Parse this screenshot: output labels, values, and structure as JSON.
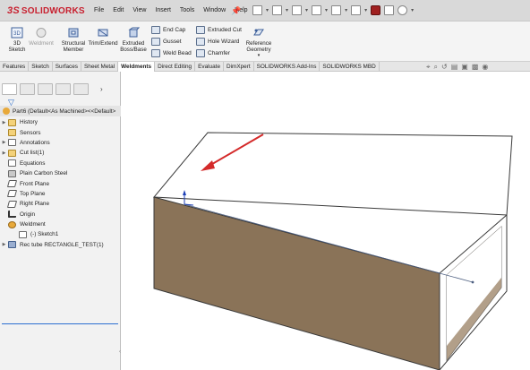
{
  "app": {
    "brand": "SOLIDWORKS",
    "brand_prefix": "3S"
  },
  "menu": [
    "File",
    "Edit",
    "View",
    "Insert",
    "Tools",
    "Window",
    "Help"
  ],
  "ribbon": {
    "buttons": [
      {
        "id": "3d-sketch",
        "label": "3D Sketch",
        "enabled": true
      },
      {
        "id": "weldment",
        "label": "Weldment",
        "enabled": false
      },
      {
        "id": "structural-member",
        "label": "Structural Member",
        "enabled": true
      },
      {
        "id": "trim-extend",
        "label": "Trim/Extend",
        "enabled": true
      },
      {
        "id": "extruded-boss",
        "label": "Extruded Boss/Base",
        "enabled": true
      }
    ],
    "small": [
      "End Cap",
      "Gusset",
      "Weld Bead",
      "Extruded Cut",
      "Hole Wizard",
      "Chamfer"
    ],
    "reference_geometry": "Reference Geometry"
  },
  "tabs": {
    "items": [
      "Features",
      "Sketch",
      "Surfaces",
      "Sheet Metal",
      "Weldments",
      "Direct Editing",
      "Evaluate",
      "DimXpert",
      "SOLIDWORKS Add-Ins",
      "SOLIDWORKS MBD"
    ],
    "active": "Weldments"
  },
  "tree": {
    "root": "Part6 (Default<As Machined><<Default>",
    "items": [
      {
        "label": "History",
        "icon": "history-icon",
        "expandable": true
      },
      {
        "label": "Sensors",
        "icon": "sensors-icon",
        "expandable": false
      },
      {
        "label": "Annotations",
        "icon": "annotations-icon",
        "expandable": true
      },
      {
        "label": "Cut list(1)",
        "icon": "cut-list-icon",
        "expandable": true
      },
      {
        "label": "Equations",
        "icon": "equations-icon",
        "expandable": false
      },
      {
        "label": "Plain Carbon Steel",
        "icon": "material-icon",
        "expandable": false
      },
      {
        "label": "Front Plane",
        "icon": "plane-icon",
        "expandable": false
      },
      {
        "label": "Top Plane",
        "icon": "plane-icon",
        "expandable": false
      },
      {
        "label": "Right Plane",
        "icon": "plane-icon",
        "expandable": false
      },
      {
        "label": "Origin",
        "icon": "origin-icon",
        "expandable": false
      },
      {
        "label": "Weldment",
        "icon": "weldment-icon",
        "expandable": false
      },
      {
        "label": "(-) Sketch1",
        "icon": "sketch-icon",
        "expandable": false,
        "sub": true
      },
      {
        "label": "Rec tube RECTANGLE_TEST(1)",
        "icon": "rec-tube-icon",
        "expandable": true
      }
    ]
  },
  "colors": {
    "arrow": "#d42a2a",
    "tube_face": "#8a7358",
    "tube_inner": "#a48e74",
    "active_tab_bg": "#ffffff",
    "selection_line": "#2c6fd1"
  }
}
